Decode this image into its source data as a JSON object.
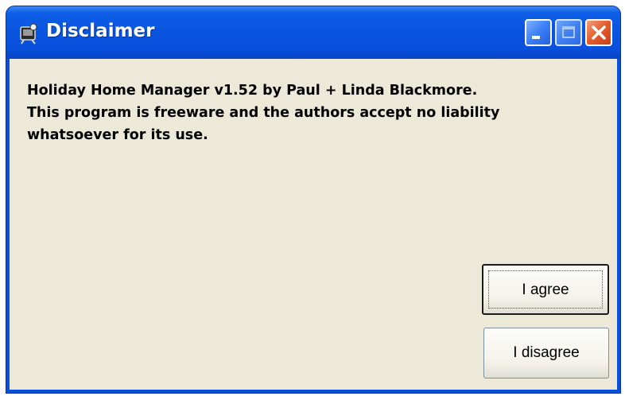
{
  "window": {
    "title": "Disclaimer",
    "icon": "app-icon",
    "controls": [
      "minimize-icon",
      "maximize-icon",
      "close-icon"
    ],
    "title_bar_color": "#0a55e0",
    "close_color": "#e35a2b",
    "body_color": "#ece9d8"
  },
  "message": {
    "line1": "Holiday Home Manager v1.52 by Paul + Linda Blackmore.",
    "line2": "This program is freeware and the authors accept no liability",
    "line3": "whatsoever for its use."
  },
  "buttons": {
    "agree_label": "I agree",
    "disagree_label": "I disagree"
  }
}
